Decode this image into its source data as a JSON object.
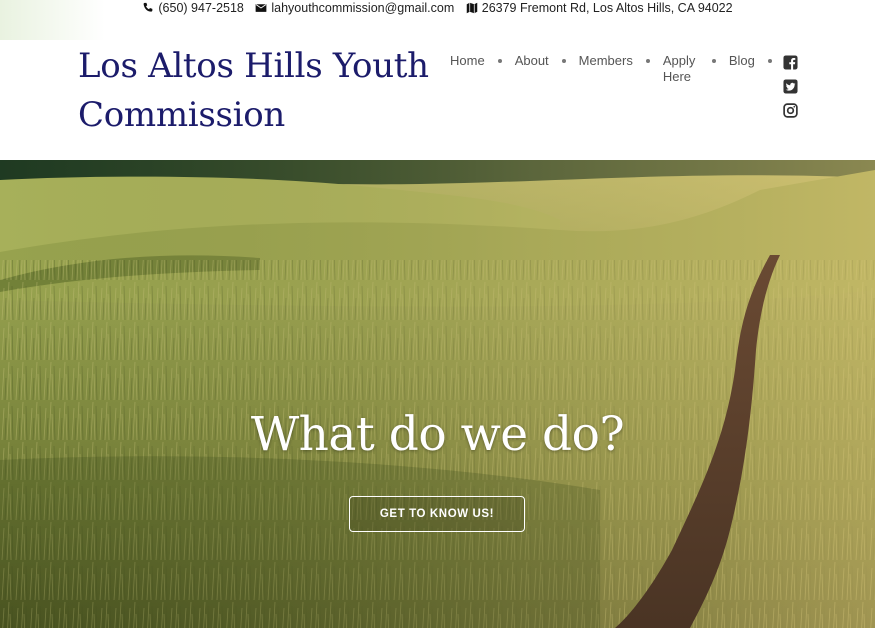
{
  "topbar": {
    "phone": "(650) 947-2518",
    "email": "lahyouthcommission@gmail.com",
    "address": "26379 Fremont Rd, Los Altos Hills, CA 94022",
    "icons": [
      "phone-icon",
      "envelope-icon",
      "map-icon"
    ]
  },
  "site": {
    "title_line1": "Los Altos Hills Youth",
    "title_line2": "Commission",
    "brand_color": "#1c1c6b"
  },
  "nav": {
    "items": [
      {
        "label": "Home"
      },
      {
        "label": "About"
      },
      {
        "label": "Members"
      },
      {
        "label": "Apply Here"
      },
      {
        "label": "Blog"
      }
    ]
  },
  "social": {
    "icons": [
      "facebook-icon",
      "twitter-icon",
      "instagram-icon"
    ]
  },
  "hero": {
    "heading": "What do we do?",
    "cta_label": "GET TO KNOW US!"
  }
}
